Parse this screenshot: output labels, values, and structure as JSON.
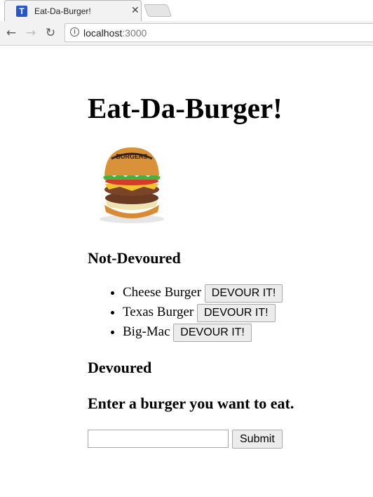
{
  "browser": {
    "tab_title": "Eat-Da-Burger!",
    "favicon_glyph": "T",
    "close_glyph": "✕",
    "url_host": "localhost",
    "url_port": ":3000",
    "nav": {
      "back_glyph": "←",
      "forward_glyph": "→",
      "reload_glyph": "↻",
      "info_glyph": "i"
    }
  },
  "page": {
    "title": "Eat-Da-Burger!",
    "burger_image_label": "BURGERS",
    "not_devoured_heading": "Not-Devoured",
    "burgers": [
      {
        "name": "Cheese Burger",
        "button": "DEVOUR IT!"
      },
      {
        "name": "Texas Burger",
        "button": "DEVOUR IT!"
      },
      {
        "name": "Big-Mac",
        "button": "DEVOUR IT!"
      }
    ],
    "devoured_heading": "Devoured",
    "form_heading": "Enter a burger you want to eat.",
    "input_value": "",
    "submit_label": "Submit"
  },
  "colors": {
    "favicon": "#2a56c6",
    "bun": "#d9923a",
    "lettuce": "#4caf3a",
    "tomato": "#d63a2a",
    "patty": "#6b3a22"
  }
}
